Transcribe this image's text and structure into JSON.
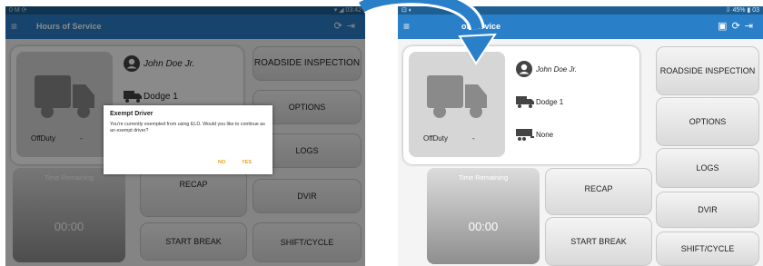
{
  "left": {
    "status_left": "0 M ⟳",
    "status_right": "▾ ◢ 03:42",
    "title": "Hours of Service",
    "driver": "John Doe Jr.",
    "vehicle": "Dodge 1",
    "duty": "OffDuty",
    "dash": "-",
    "time_label": "Time Remaining",
    "time_value": "00:00",
    "buttons": [
      "ROADSIDE INSPECTION",
      "OPTIONS",
      "LOGS",
      "DVIR",
      "RECAP",
      "START BREAK",
      "SHIFT/CYCLE"
    ],
    "dialog": {
      "title": "Exempt Driver",
      "message": "You're currently exempted from using ELD. Would you like to continue as an exempt driver?",
      "no": "NO",
      "yes": "YES"
    }
  },
  "right": {
    "status_left": "⊡ ◐",
    "status_right": "⇩ 45% ▮ 03",
    "title": "of Service",
    "driver": "John Doe Jr.",
    "vehicle": "Dodge 1",
    "trailer": "None",
    "duty": "OffDuty",
    "dash": "-",
    "time_label": "Time Remaining",
    "time_value": "00:00",
    "buttons": [
      "ROADSIDE INSPECTION",
      "OPTIONS",
      "LOGS",
      "DVIR",
      "SHIFT/CYCLE",
      "RECAP",
      "START BREAK"
    ]
  },
  "colors": {
    "appbar": "#2a7fc9",
    "statusbar": "#1e5f93",
    "dialog_buttons": "#e6a21a",
    "arrow": "#2a7fc9"
  }
}
